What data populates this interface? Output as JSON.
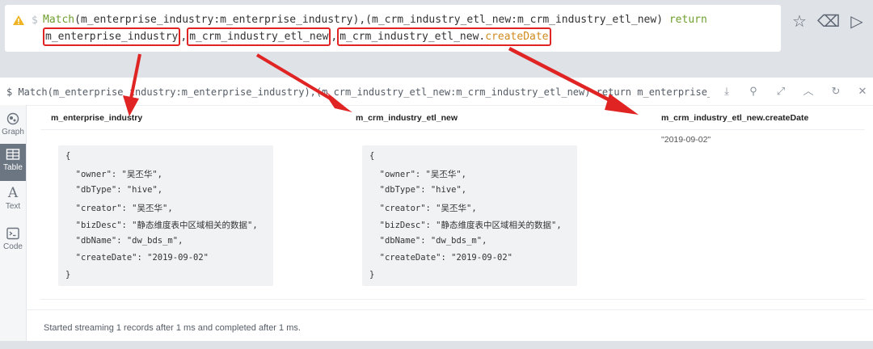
{
  "editor": {
    "prompt": "$",
    "line1": {
      "match_kw": "Match",
      "pattern": "(m_enterprise_industry:m_enterprise_industry),(m_crm_industry_etl_new:m_crm_industry_etl_new) ",
      "return_kw": "return"
    },
    "line2": {
      "item1": "m_enterprise_industry",
      "sep1": ",",
      "item2": "m_crm_industry_etl_new",
      "sep2": ",",
      "item3_prefix": "m_crm_industry_etl_new.",
      "item3_fn": "createDate"
    },
    "buttons": {
      "favorite": "☆",
      "clear": "⌫",
      "run": "▷"
    }
  },
  "frame": {
    "query": "$ Match(m_enterprise_industry:m_enterprise_industry),(m_crm_industry_etl_new:m_crm_industry_etl_new) return m_enterprise_industry,m_…",
    "buttons": {
      "download": "⤓",
      "pin": "⚲",
      "expand": "⤢",
      "collapse": "︿",
      "rerun": "↻",
      "close": "✕"
    }
  },
  "sidebar": {
    "items": [
      {
        "label": "Graph",
        "icon": "graph-icon"
      },
      {
        "label": "Table",
        "icon": "table-icon"
      },
      {
        "label": "Text",
        "icon": "text-icon"
      },
      {
        "label": "Code",
        "icon": "code-icon"
      }
    ],
    "active": "Table"
  },
  "table": {
    "columns": [
      "m_enterprise_industry",
      "m_crm_industry_etl_new",
      "m_crm_industry_etl_new.createDate"
    ],
    "rows": [
      {
        "col1": [
          "{",
          "  \"owner\": \"吴丕华\",",
          "  \"dbType\": \"hive\",",
          "  \"creator\": \"吴丕华\",",
          "  \"bizDesc\": \"静态维度表中区域相关的数据\",",
          "  \"dbName\": \"dw_bds_m\",",
          "  \"createDate\": \"2019-09-02\"",
          "}"
        ],
        "col2": [
          "{",
          "  \"owner\": \"吴丕华\",",
          "  \"dbType\": \"hive\",",
          "  \"creator\": \"吴丕华\",",
          "  \"bizDesc\": \"静态维度表中区域相关的数据\",",
          "  \"dbName\": \"dw_bds_m\",",
          "  \"createDate\": \"2019-09-02\"",
          "}"
        ],
        "col3": "\"2019-09-02\""
      }
    ]
  },
  "status": "Started streaming 1 records after 1 ms and completed after 1 ms.",
  "colors": {
    "annotation": "#e02424",
    "keyword": "#6f9f2e",
    "function": "#d08b1f",
    "active_tab": "#6c7682"
  }
}
